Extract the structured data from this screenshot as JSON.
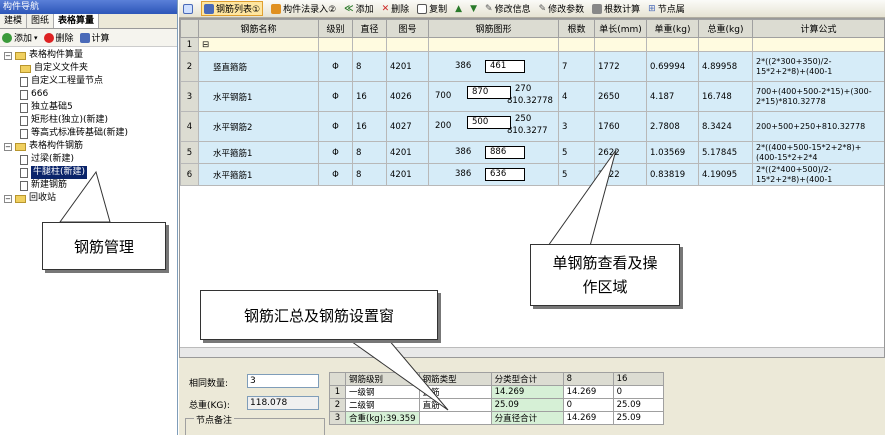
{
  "left_panel": {
    "title": "构件导航",
    "tabs": [
      "建模",
      "图纸",
      "表格算量"
    ],
    "toolbar": {
      "add": "添加",
      "delete": "删除",
      "calc": "计算"
    },
    "tree": [
      {
        "label": "表格构件算量",
        "level": 0,
        "icon": "folder"
      },
      {
        "label": "自定义文件夹",
        "level": 1,
        "icon": "folder"
      },
      {
        "label": "自定义工程量节点",
        "level": 1,
        "icon": "doc"
      },
      {
        "label": "666",
        "level": 1,
        "icon": "doc"
      },
      {
        "label": "独立基础5",
        "level": 1,
        "icon": "doc"
      },
      {
        "label": "矩形柱(独立)(新建)",
        "level": 1,
        "icon": "doc"
      },
      {
        "label": "等高式标准砖基础(新建)",
        "level": 1,
        "icon": "doc"
      },
      {
        "label": "表格构件钢筋",
        "level": 0,
        "icon": "folder"
      },
      {
        "label": "过梁(新建)",
        "level": 1,
        "icon": "doc"
      },
      {
        "label": "牛腿柱(新建)",
        "level": 1,
        "icon": "doc",
        "selected": true
      },
      {
        "label": "新建钢筋",
        "level": 1,
        "icon": "doc"
      },
      {
        "label": "回收站",
        "level": 0,
        "icon": "folder"
      }
    ]
  },
  "toolbar": {
    "rebar_list": "钢筋列表①",
    "component_entry": "构件法录入②",
    "add": "添加",
    "delete": "删除",
    "copy": "复制",
    "modify_info": "修改信息",
    "modify_params": "修改参数",
    "count_calc": "根数计算",
    "node_points": "节点属"
  },
  "grid": {
    "columns": [
      "钢筋名称",
      "级别",
      "直径",
      "图号",
      "钢筋图形",
      "根数",
      "单长(mm)",
      "单重(kg)",
      "总重(kg)",
      "计算公式"
    ],
    "rows": [
      {
        "num": "1",
        "name": "⊟",
        "grade": "",
        "dia": "",
        "fig": "",
        "shape": {
          "type": "none"
        },
        "count": "",
        "len": "",
        "unit_w": "",
        "total_w": "",
        "formula": ""
      },
      {
        "num": "2",
        "name": "竖直箍筋",
        "grade": "Φ",
        "dia": "8",
        "fig": "4201",
        "shape": {
          "type": "stirrup",
          "left": "386",
          "box": "461"
        },
        "count": "7",
        "len": "1772",
        "unit_w": "0.69994",
        "total_w": "4.89958",
        "formula": "2*((2*300+350)/2-15*2+2*8)+(400-1"
      },
      {
        "num": "3",
        "name": "水平钢筋1",
        "grade": "Φ",
        "dia": "16",
        "fig": "4026",
        "shape": {
          "type": "bent",
          "left": "700",
          "box": "870",
          "right": "270",
          "tail": "810.32778"
        },
        "count": "4",
        "len": "2650",
        "unit_w": "4.187",
        "total_w": "16.748",
        "formula": "700+(400+500-2*15)+(300-2*15)*810.32778"
      },
      {
        "num": "4",
        "name": "水平钢筋2",
        "grade": "Φ",
        "dia": "16",
        "fig": "4027",
        "shape": {
          "type": "bent",
          "left": "200",
          "box": "500",
          "right": "250",
          "tail": "810.3277"
        },
        "count": "3",
        "len": "1760",
        "unit_w": "2.7808",
        "total_w": "8.3424",
        "formula": "200+500+250+810.32778"
      },
      {
        "num": "5",
        "name": "水平箍筋1",
        "grade": "Φ",
        "dia": "8",
        "fig": "4201",
        "shape": {
          "type": "stirrup",
          "left": "386",
          "box": "886"
        },
        "count": "5",
        "len": "2622",
        "unit_w": "1.03569",
        "total_w": "5.17845",
        "formula": "2*((400+500-15*2+2*8)+(400-15*2+2*4"
      },
      {
        "num": "6",
        "name": "水平箍筋1",
        "grade": "Φ",
        "dia": "8",
        "fig": "4201",
        "shape": {
          "type": "stirrup",
          "left": "386",
          "box": "636"
        },
        "count": "5",
        "len": "2122",
        "unit_w": "0.83819",
        "total_w": "4.19095",
        "formula": "2*((2*400+500)/2-15*2+2*8)+(400-1"
      }
    ]
  },
  "bottom": {
    "same_count_label": "相同数量:",
    "same_count_value": "3",
    "total_weight_label": "总重(KG):",
    "total_weight_value": "118.078",
    "node_note_label": "节点备注",
    "summary": {
      "headers": [
        "",
        "钢筋级别",
        "钢筋类型",
        "分类型合计",
        "8",
        "16"
      ],
      "rows": [
        [
          "1",
          "一级钢",
          "直筋",
          "14.269",
          "14.269",
          "0"
        ],
        [
          "2",
          "二级钢",
          "直筋",
          "25.09",
          "0",
          "25.09"
        ],
        [
          "3",
          "合重(kg):39.359",
          "",
          "分直径合计",
          "14.269",
          "25.09"
        ]
      ]
    }
  },
  "callouts": {
    "rebar_mgmt": "钢筋管理",
    "single_rebar": "单钢筋查看及操作区域",
    "summary_window": "钢筋汇总及钢筋设置窗"
  },
  "colors": {
    "accent": "#0a246a",
    "grid_row": "#d6ecf8",
    "header": "#dcdcd2"
  }
}
